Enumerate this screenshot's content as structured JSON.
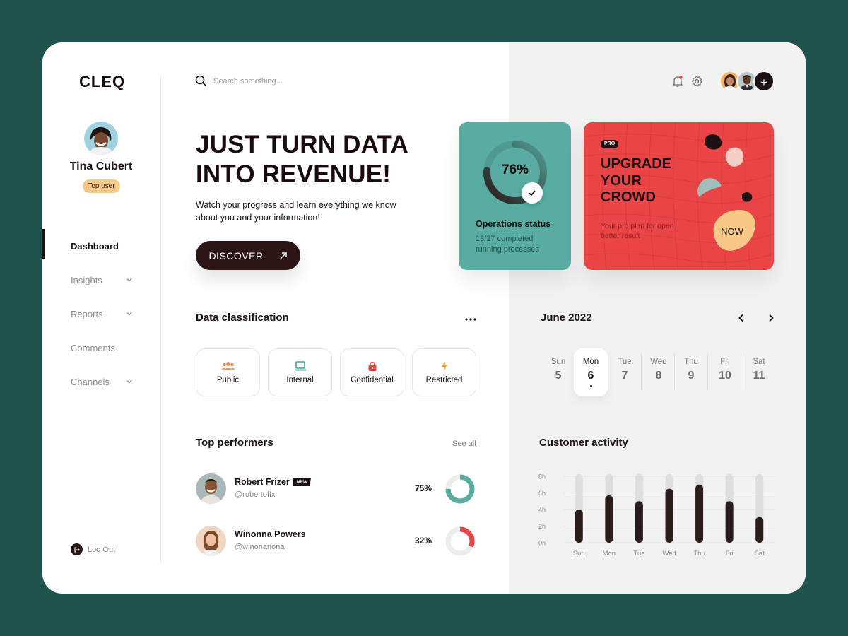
{
  "app": {
    "logo": "CLEQ"
  },
  "profile": {
    "name": "Tina Cubert",
    "badge": "Top user"
  },
  "nav": {
    "items": [
      {
        "label": "Dashboard",
        "active": true,
        "has_chevron": false
      },
      {
        "label": "Insights",
        "active": false,
        "has_chevron": true
      },
      {
        "label": "Reports",
        "active": false,
        "has_chevron": true
      },
      {
        "label": "Comments",
        "active": false,
        "has_chevron": false
      },
      {
        "label": "Channels",
        "active": false,
        "has_chevron": true
      }
    ],
    "logout": "Log Out"
  },
  "header": {
    "search_placeholder": "Search something...",
    "add_label": "+"
  },
  "hero": {
    "title_line1": "JUST TURN DATA",
    "title_line2": "INTO REVENUE!",
    "subtitle": "Watch your progress and learn everything we know about you and your information!",
    "cta": "DISCOVER"
  },
  "operations": {
    "percent": "76%",
    "progress": 0.76,
    "title": "Operations status",
    "subtitle": "13/27 completed running processes"
  },
  "pro_card": {
    "badge": "PRO",
    "title_line1": "UPGRADE",
    "title_line2": "YOUR",
    "title_line3": "CROWD",
    "subtitle": "Your pro plan for open better result",
    "cta": "NOW"
  },
  "data_classification": {
    "title": "Data classification",
    "chips": [
      {
        "label": "Public",
        "icon": "users-icon",
        "color": "#f08a5d"
      },
      {
        "label": "Internal",
        "icon": "laptop-icon",
        "color": "#3f9e94"
      },
      {
        "label": "Confidential",
        "icon": "lock-icon",
        "color": "#e94446"
      },
      {
        "label": "Restricted",
        "icon": "lightning-icon",
        "color": "#f2a23a"
      }
    ]
  },
  "top_performers": {
    "title": "Top performers",
    "see_all": "See all",
    "items": [
      {
        "name": "Robert Frizer",
        "badge": "NEW",
        "handle": "@robertoffx",
        "percent": "75%",
        "progress": 0.75,
        "color": "#58aca2"
      },
      {
        "name": "Winonna Powers",
        "badge": "",
        "handle": "@winonanona",
        "percent": "32%",
        "progress": 0.32,
        "color": "#e94446"
      }
    ]
  },
  "calendar": {
    "title": "June 2022",
    "days": [
      {
        "dow": "Sun",
        "num": "5",
        "selected": false
      },
      {
        "dow": "Mon",
        "num": "6",
        "selected": true
      },
      {
        "dow": "Tue",
        "num": "7",
        "selected": false
      },
      {
        "dow": "Wed",
        "num": "8",
        "selected": false
      },
      {
        "dow": "Thu",
        "num": "9",
        "selected": false
      },
      {
        "dow": "Fri",
        "num": "10",
        "selected": false
      },
      {
        "dow": "Sat",
        "num": "11",
        "selected": false
      }
    ]
  },
  "chart_data": {
    "type": "bar",
    "title": "Customer activity",
    "categories": [
      "Sun",
      "Mon",
      "Tue",
      "Wed",
      "Thu",
      "Fri",
      "Sat"
    ],
    "values": [
      4,
      5.7,
      5,
      6.5,
      7,
      5,
      3.1
    ],
    "yticks": [
      "8h",
      "6h",
      "4h",
      "2h",
      "0h"
    ],
    "ylim": [
      0,
      8
    ],
    "grid": true,
    "bar_color": "#2a1c1c",
    "track_color": "#dedede"
  },
  "colors": {
    "teal": "#58aca2",
    "red": "#e94446",
    "dark": "#1d1111",
    "peach": "#f8c887"
  }
}
